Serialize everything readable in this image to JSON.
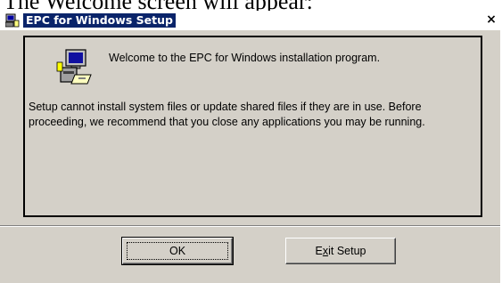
{
  "document": {
    "caption": "The Welcome screen will appear:"
  },
  "window": {
    "title": "EPC for Windows Setup",
    "close_glyph": "×"
  },
  "panel": {
    "welcome": "Welcome to the EPC for Windows installation program.",
    "message": "Setup cannot install system files or update shared files if they are in use. Before proceeding, we recommend that you close any applications you may be running."
  },
  "buttons": {
    "ok": "OK",
    "exit_before": "E",
    "exit_accel": "x",
    "exit_after": "it Setup"
  },
  "icons": {
    "app": "computer-setup-icon",
    "setup": "computer-disk-setup-icon"
  }
}
